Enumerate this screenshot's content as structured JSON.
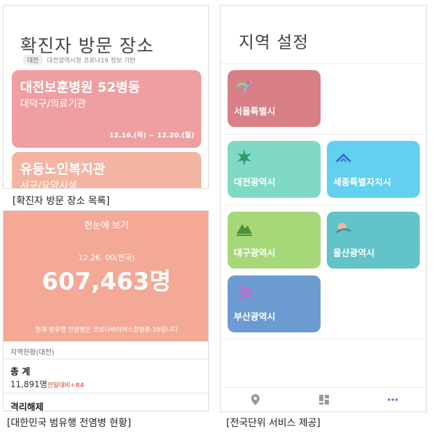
{
  "visit_panel": {
    "title": "확진자 방문 장소",
    "region_tag": "대전",
    "source": "대전광역시청 코로나19 정보 기반",
    "places": [
      {
        "name": "대전보훈병원 52병동",
        "type": "대덕구/의료기관",
        "date": "12.16.(목) ~ 12.20.(월)",
        "color": "#ef9fa2"
      },
      {
        "name": "유등노인복지관",
        "type": "서구/요양시설",
        "date": "",
        "color": "#f3b5a1"
      }
    ],
    "caption": "[확진자 방문 장소 목록]"
  },
  "status_panel": {
    "view_all": "한눈에 보기",
    "date_line": "12.26. 00(전국)",
    "total_count": "607,463명",
    "note": "현재 범유행 전염병은 코로나바이러스감염증-19입니다",
    "region_header": "지역현황(대전)",
    "total_label": "총 계",
    "total_value": "11,891명",
    "delta": "전일대비+84",
    "release_label": "격리해제",
    "caption": "[대한민국 범유행 전염병 현황]"
  },
  "region_panel": {
    "title": "지역 설정",
    "regions": [
      {
        "name": "서울특별시",
        "color": "#d97f86",
        "icon": "seoul-logo-icon"
      },
      {
        "name": "대전광역시",
        "color": "#7fd9c4",
        "icon": "daejeon-logo-icon"
      },
      {
        "name": "세종특별자치시",
        "color": "#62d0ee",
        "icon": "sejong-logo-icon"
      },
      {
        "name": "대구광역시",
        "color": "#a6d87a",
        "icon": "daegu-logo-icon"
      },
      {
        "name": "울산광역시",
        "color": "#62c3c9",
        "icon": "ulsan-logo-icon"
      },
      {
        "name": "부산광역시",
        "color": "#6b9bd1",
        "icon": "busan-logo-icon"
      }
    ],
    "nav": [
      "location-pin-icon",
      "dashboard-grid-icon",
      "more-dots-icon"
    ],
    "caption": "[전국단위 서비스 제공]"
  }
}
